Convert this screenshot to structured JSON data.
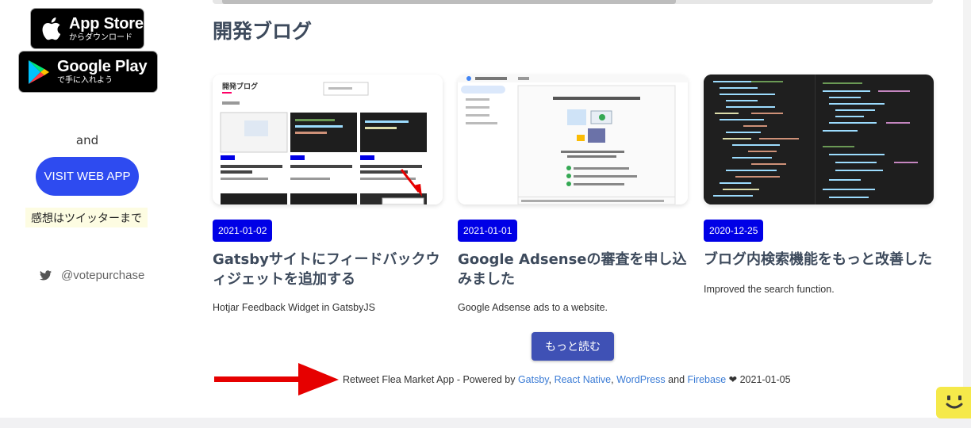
{
  "sidebar": {
    "app_store": {
      "title": "App Store",
      "subtitle": "からダウンロード"
    },
    "google_play": {
      "title": "Google Play",
      "subtitle": "で手に入れよう"
    },
    "and_text": "and",
    "visit_button": "VISIT WEB APP",
    "twitter_note": "感想はツイッターまで",
    "twitter_handle": "@votepurchase"
  },
  "main": {
    "section_title": "開発ブログ",
    "posts": [
      {
        "date": "2021-01-02",
        "title": "Gatsbyサイトにフィードバックウィジェットを追加する",
        "description": "Hotjar Feedback Widget in GatsbyJS",
        "thumbnail": "blog-page-screenshot"
      },
      {
        "date": "2021-01-01",
        "title": "Google Adsenseの審査を申し込みました",
        "description": "Google Adsense ads to a website.",
        "thumbnail": "adsense-screenshot"
      },
      {
        "date": "2020-12-25",
        "title": "ブログ内検索機能をもっと改善した",
        "description": "Improved the search function.",
        "thumbnail": "code-editor-screenshot"
      }
    ],
    "more_button": "もっと読む"
  },
  "footer": {
    "prefix": "Retweet Flea Market App - Powered by",
    "links": [
      "Gatsby",
      "React Native",
      "WordPress",
      "Firebase"
    ],
    "and": "and",
    "heart": "❤",
    "date": "2021-01-05"
  },
  "colors": {
    "accent_blue": "#2e4bf0",
    "date_badge": "#0000e6",
    "more_button": "#3f51b5",
    "link": "#3a7bd5",
    "arrow": "#e60000",
    "feedback_tab": "#f5e94a"
  }
}
